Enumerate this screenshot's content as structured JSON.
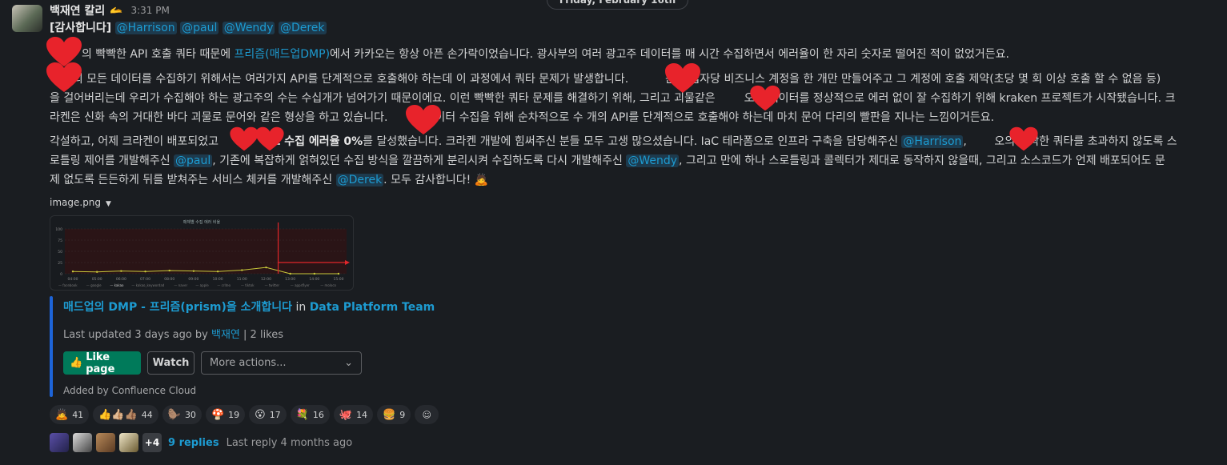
{
  "date_divider": "Friday, February 16th",
  "message": {
    "sender": "백재연 칼리",
    "status_emoji": "🫴",
    "time": "3:31 PM",
    "header_line": {
      "prefix": "[감사합니다]",
      "mentions": [
        "@Harrison",
        "@paul",
        "@Wendy",
        "@Derek"
      ]
    },
    "p1": {
      "a": "의 빡빡한 API 호출 쿼타 때문에 ",
      "link": "프리즘(매드업DMP)",
      "b": "에서 카카오는 항상 아픈 손가락이었습니다. 광사부의 여러 광고주 데이터를 매 시간 수집하면서 에러율이 한 자리 숫자로 떨어진 적이 없었거든요."
    },
    "p2": {
      "line1": "오의 모든 데이터를 수집하기 위해서는 여러가지 API를 단계적으로 호출해야 하는데 이 과정에서 쿼타 문제가 발생합니다.",
      "line1b": "는 사업자당 비즈니스 계정을 한 개만 만들어주고 그 계정에 호출 제약(초당 몇 회 이상 호출 할 수 없음 등)",
      "line2a": "을 걸어버리는데 우리가 수집해야 하는 광고주의 수는 수십개가 넘어가기 때문이에요. 이런 빡빡한 쿼타 문제를 해결하기 위해, 그리고 괴물같은",
      "line2b": "오의 데이터를 정상적으로 에러 없이 잘 수집하기 위해 kraken 프로젝트가 시작됐습니다. 크",
      "line3a": "라켄은 신화 속의 거대한 바다 괴물로 문어와 같은 형상을 하고 있습니다.",
      "line3b": "데이터 수집을 위해 순차적으로 수 개의 API를 단계적으로 호출해야 하는데 마치 문어 다리의 빨판을 지나는 느낌이거든요."
    },
    "p3": {
      "a": "각설하고, 어제 크라켄이 배포되었고 ",
      "bold": "트 수집 에러율 0%",
      "b": "를 달성했습니다. 크라켄 개발에 힘써주신 분들 모두 고생 많으셨습니다. IaC 테라폼으로 인프라 구축을 담당해주신 ",
      "m1": "@Harrison",
      "c": ", ",
      "d": "오의 빡빡한 쿼타를 초과하지 않도록 스",
      "e": "로틀링 제어를 개발해주신 ",
      "m2": "@paul",
      "f": ", 기존에 복잡하게 얽혀있던 수집 방식을 깔끔하게 분리시켜 수집하도록 다시 개발해주신 ",
      "m3": "@Wendy",
      "g": ", 그리고 만에 하나 스로틀링과 콜렉터가 제대로 동작하지 않을때, 그리고 소스코드가 언제 배포되어도 문",
      "h": "제 없도록 든든하게 뒤를 받쳐주는 서비스 체커를 개발해주신 ",
      "m4": "@Derek",
      "i": ". 모두 감사합니다! ",
      "emoji": "🙇"
    },
    "file_name": "image.png"
  },
  "chart_data": {
    "type": "line",
    "title": "매체별 수집 에러 비율",
    "x": [
      "04:00",
      "05:00",
      "06:00",
      "07:00",
      "08:00",
      "09:00",
      "10:00",
      "11:00",
      "12:00",
      "13:00",
      "14:00",
      "15:00"
    ],
    "series": [
      {
        "name": "kakao",
        "values": [
          5,
          4,
          6,
          5,
          7,
          6,
          5,
          8,
          14,
          0,
          0,
          0
        ]
      }
    ],
    "yticks": [
      "100",
      "75",
      "50",
      "25",
      "0"
    ],
    "ylim": [
      0,
      100
    ],
    "legend": [
      "facebook",
      "google",
      "kakao",
      "kakao_keywordad",
      "naver",
      "apple",
      "criteo",
      "tiktok",
      "twitter",
      "appsflyer",
      "moloco"
    ],
    "colors": {
      "line": "#c8c93a",
      "marker": "#e0262b",
      "bg": "#2a1416"
    }
  },
  "unfurl": {
    "title": "매드업의 DMP - 프리즘(prism)을 소개합니다",
    "in_word": " in ",
    "space": "Data Platform Team",
    "meta_prefix": "Last updated 3 days ago by ",
    "meta_author": "백재연",
    "meta_suffix": " | 2 likes",
    "like_label": "Like page",
    "watch_label": "Watch",
    "more_label": "More actions...",
    "footer": "Added by Confluence Cloud"
  },
  "reactions": [
    {
      "emoji": "🙇",
      "count": "41"
    },
    {
      "emoji": "👍👍🏼👍🏽",
      "count": "44"
    },
    {
      "emoji": "🦫",
      "count": "30"
    },
    {
      "emoji": "🍄",
      "count": "19"
    },
    {
      "emoji": "😮",
      "count": "17"
    },
    {
      "emoji": "💐",
      "count": "16"
    },
    {
      "emoji": "🐙",
      "count": "14"
    },
    {
      "emoji": "🍔",
      "count": "9"
    }
  ],
  "thread": {
    "more_count": "+4",
    "replies": "9 replies",
    "last_reply": "Last reply 4 months ago"
  }
}
